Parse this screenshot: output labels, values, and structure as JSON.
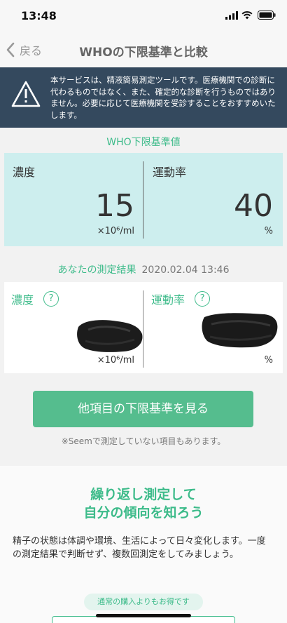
{
  "status_bar": {
    "time": "13:48"
  },
  "nav": {
    "back_label": "戻る",
    "title": "WHOの下限基準と比較"
  },
  "disclaimer": {
    "text": "本サービスは、精液簡易測定ツールです。医療機関での診断に代わるものではなく、また、確定的な診断を行うものではありません。必要に応じて医療機関を受診することをおすすめいたします。"
  },
  "who": {
    "label": "WHO下限基準値",
    "concentration": {
      "label": "濃度",
      "value": "15",
      "unit": "×10⁶/ml"
    },
    "motility": {
      "label": "運動率",
      "value": "40",
      "unit": "%"
    }
  },
  "result": {
    "label": "あなたの測定結果",
    "date": "2020.02.04 13:46",
    "concentration": {
      "label": "濃度",
      "unit": "×10⁶/ml"
    },
    "motility": {
      "label": "運動率",
      "unit": "%"
    },
    "help_symbol": "?"
  },
  "cta": {
    "label": "他項目の下限基準を見る"
  },
  "note": "※Seemで測定していない項目もあります。",
  "promo": {
    "heading_line1": "繰り返し測定して",
    "heading_line2": "自分の傾向を知ろう",
    "body": "精子の状態は体調や環境、生活によって日々変化します。一度の測定結果で判断せず、複数回測定をしてみましょう。",
    "pill": "通常の購入よりもお得です"
  },
  "colors": {
    "accent": "#3dbb8a",
    "button": "#55bd8e",
    "banner": "#34495e",
    "who_panel": "#cdeeee"
  }
}
